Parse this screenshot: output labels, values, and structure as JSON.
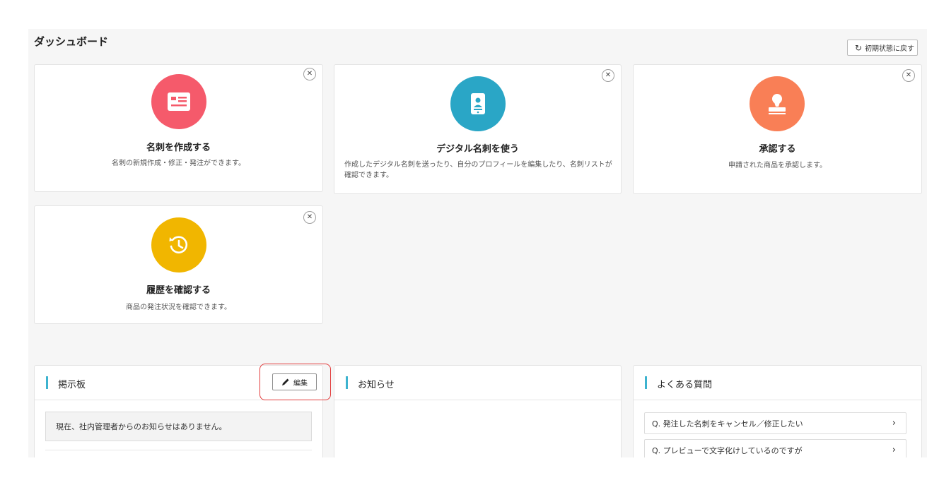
{
  "page": {
    "title": "ダッシュボード",
    "reset_label": "初期状態に戻す"
  },
  "cards": [
    {
      "title": "名刺を作成する",
      "description": "名刺の新規作成・修正・発注ができます。",
      "color": "#f55a6b",
      "icon": "business-card-icon"
    },
    {
      "title": "デジタル名刺を使う",
      "description": "作成したデジタル名刺を送ったり、自分のプロフィールを編集したり、名刺リストが確認できます。",
      "color": "#2aa6c6",
      "icon": "mobile-profile-icon"
    },
    {
      "title": "承認する",
      "description": "申請された商品を承認します。",
      "color": "#f97f56",
      "icon": "stamp-icon"
    },
    {
      "title": "履歴を確認する",
      "description": "商品の発注状況を確認できます。",
      "color": "#f1b600",
      "icon": "history-icon"
    }
  ],
  "panels": {
    "board": {
      "title": "掲示板",
      "edit_label": "編集",
      "notice": "現在、社内管理者からのお知らせはありません。"
    },
    "news": {
      "title": "お知らせ"
    },
    "faq": {
      "title": "よくある質問",
      "items": [
        {
          "label": "Q. 発注した名刺をキャンセル／修正したい"
        },
        {
          "label": "Q. プレビューで文字化けしているのですが"
        }
      ]
    }
  },
  "accent_color": "#3db3cf",
  "highlight_color": "#e23b3b"
}
